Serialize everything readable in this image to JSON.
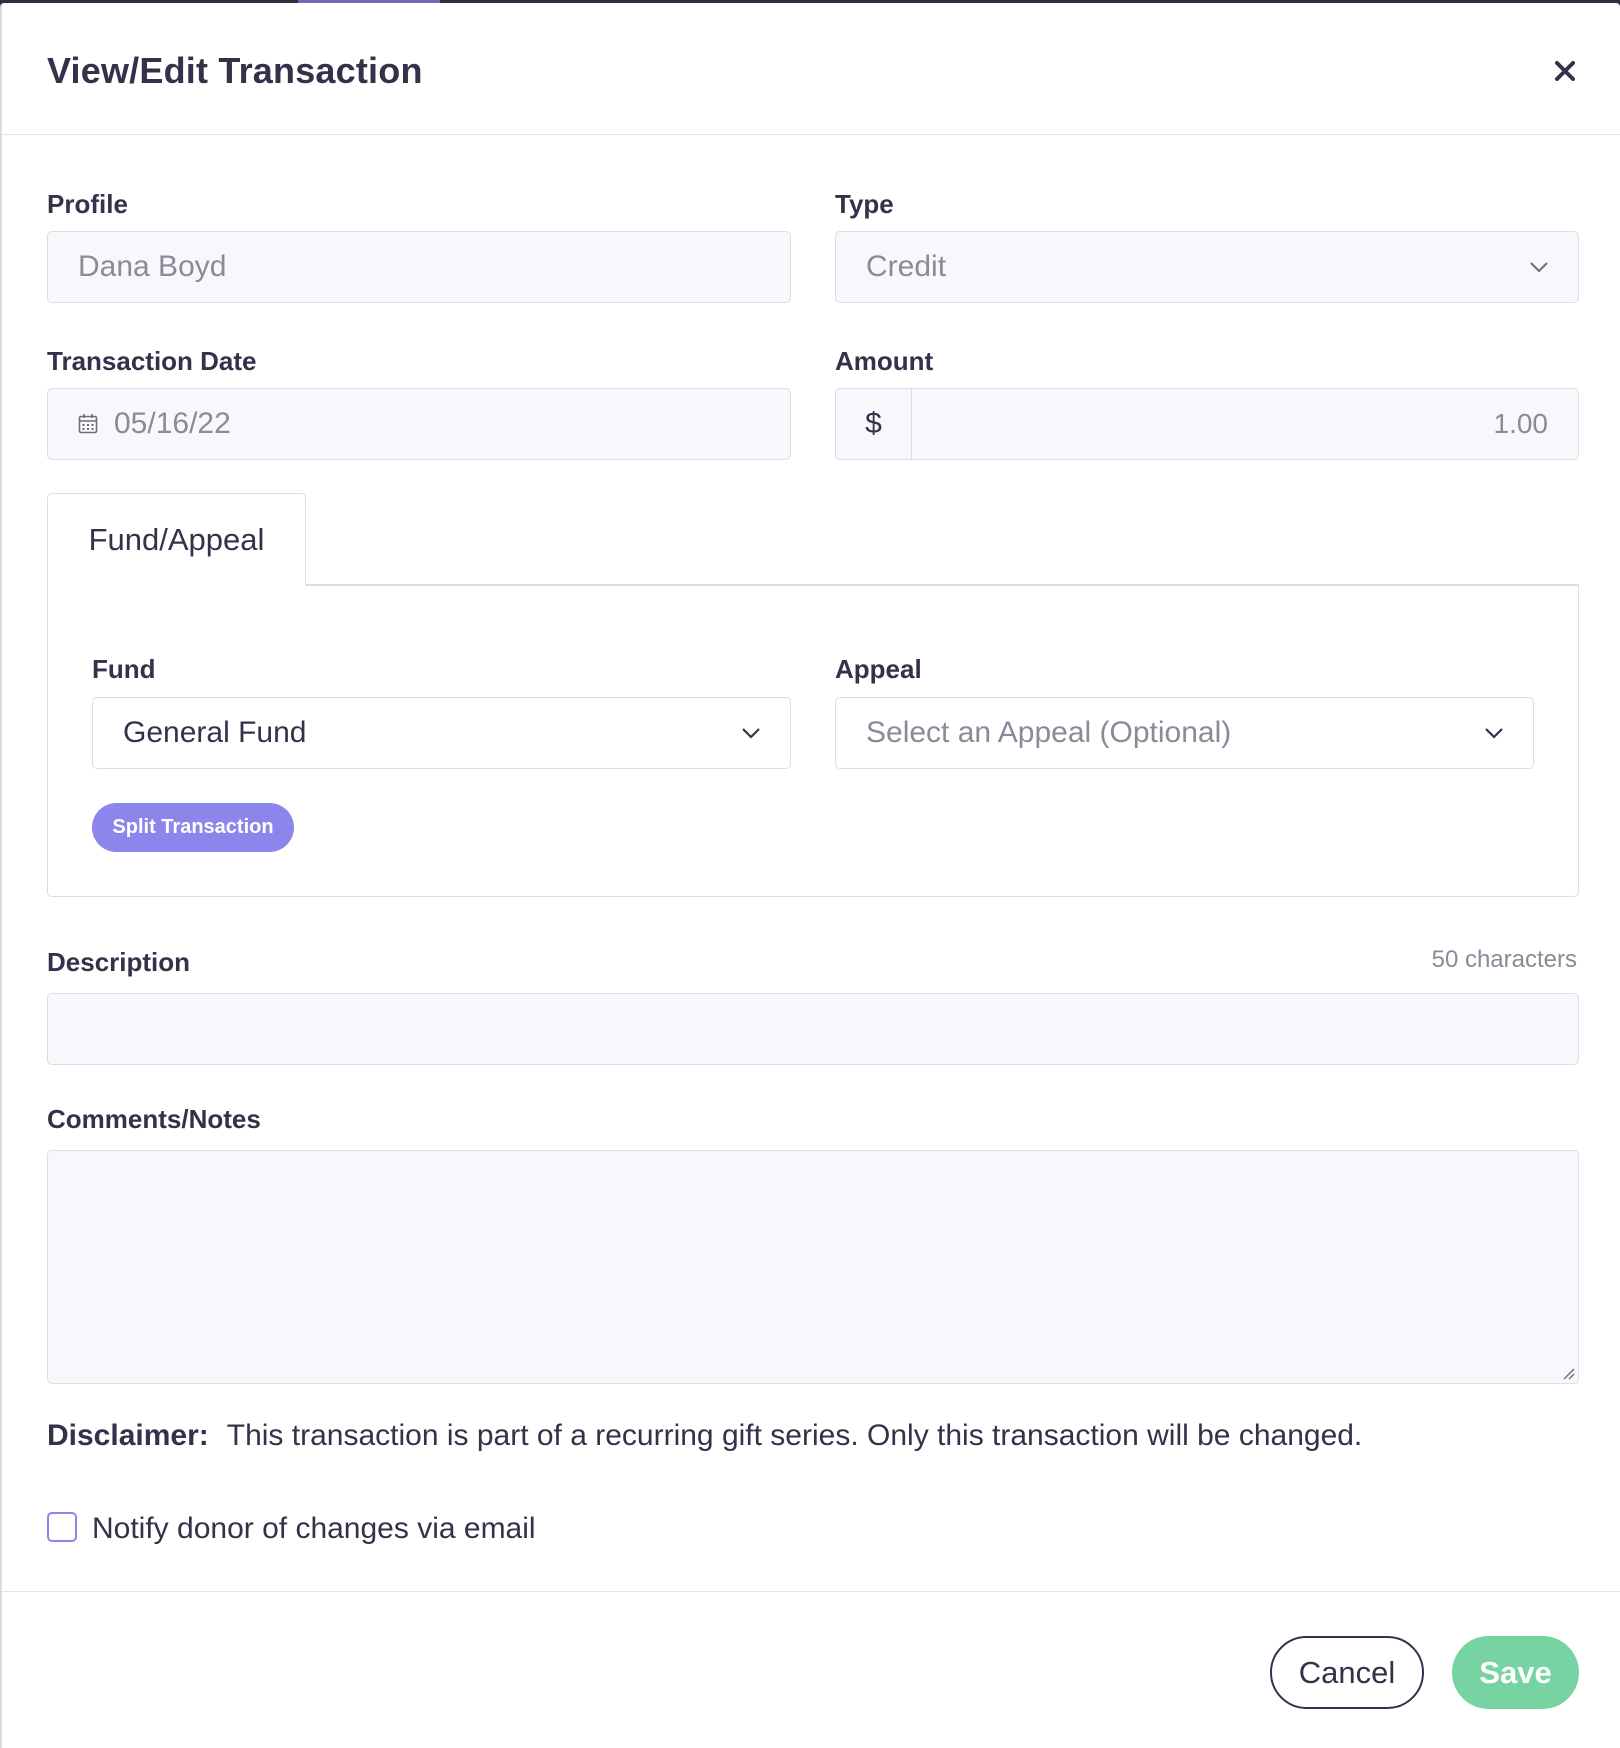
{
  "modal": {
    "title": "View/Edit Transaction"
  },
  "profile": {
    "label": "Profile",
    "value": "Dana Boyd"
  },
  "type": {
    "label": "Type",
    "value": "Credit"
  },
  "transaction_date": {
    "label": "Transaction Date",
    "value": "05/16/22"
  },
  "amount": {
    "label": "Amount",
    "prefix": "$",
    "value": "1.00"
  },
  "tabs": [
    {
      "label": "Fund/Appeal",
      "active": true
    }
  ],
  "fund": {
    "label": "Fund",
    "value": "General Fund"
  },
  "appeal": {
    "label": "Appeal",
    "placeholder": "Select an Appeal (Optional)"
  },
  "split_button": {
    "label": "Split Transaction"
  },
  "description": {
    "label": "Description",
    "char_count": "50 characters",
    "value": ""
  },
  "comments": {
    "label": "Comments/Notes",
    "value": ""
  },
  "disclaimer": {
    "label": "Disclaimer:",
    "text": "This transaction is part of a recurring gift series. Only this transaction will be changed."
  },
  "notify": {
    "label": "Notify donor of changes via email",
    "checked": false
  },
  "footer": {
    "cancel_label": "Cancel",
    "save_label": "Save"
  },
  "colors": {
    "accent": "#8b85ec",
    "save": "#78d3a2",
    "text": "#33324a",
    "muted": "#8a8a99",
    "field_bg": "#f8f8fc"
  },
  "icons": [
    "close-icon",
    "chevron-down-icon",
    "calendar-icon",
    "resize-handle-icon"
  ]
}
